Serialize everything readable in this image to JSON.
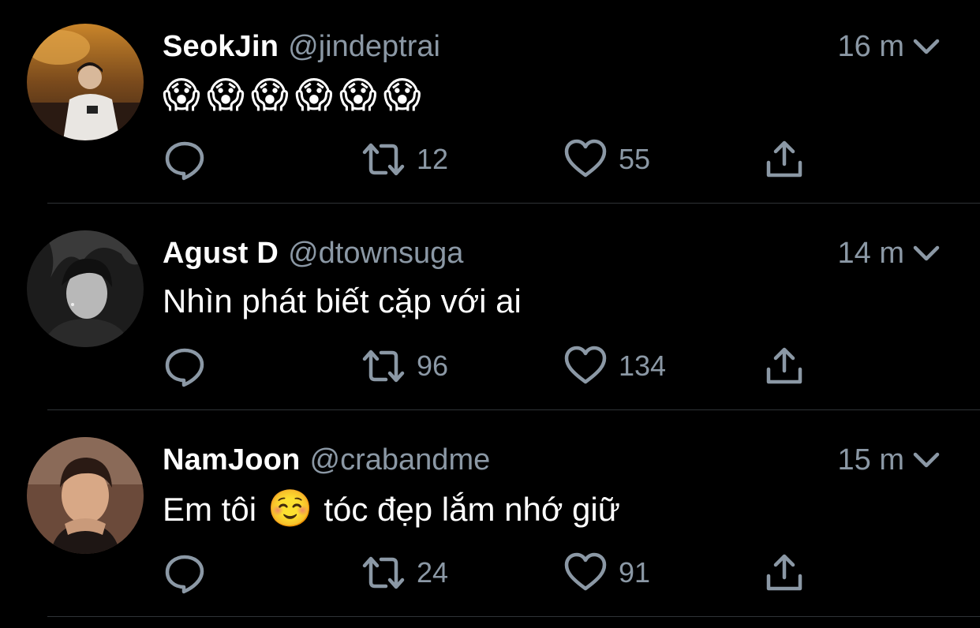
{
  "colors": {
    "background": "#000000",
    "primary_text": "#ffffff",
    "secondary_text": "#8b98a5",
    "divider": "#2f3336"
  },
  "icons": {
    "reply": "reply-bubble-icon",
    "retweet": "retweet-icon",
    "like": "heart-icon",
    "share": "share-upload-icon",
    "more": "chevron-down-icon"
  },
  "tweets": [
    {
      "display_name": "SeokJin",
      "handle": "@jindeptrai",
      "time": "16 m",
      "text": "😱😱😱😱😱😱",
      "retweets": "12",
      "likes": "55"
    },
    {
      "display_name": "Agust D",
      "handle": "@dtownsuga",
      "time": "14 m",
      "text": "Nhìn phát biết cặp với ai",
      "retweets": "96",
      "likes": "134"
    },
    {
      "display_name": "NamJoon",
      "handle": "@crabandme",
      "time": "15 m",
      "text_before": "Em tôi",
      "text_emoji": "☺️",
      "text_after": "tóc đẹp lắm nhớ giữ",
      "retweets": "24",
      "likes": "91"
    }
  ]
}
